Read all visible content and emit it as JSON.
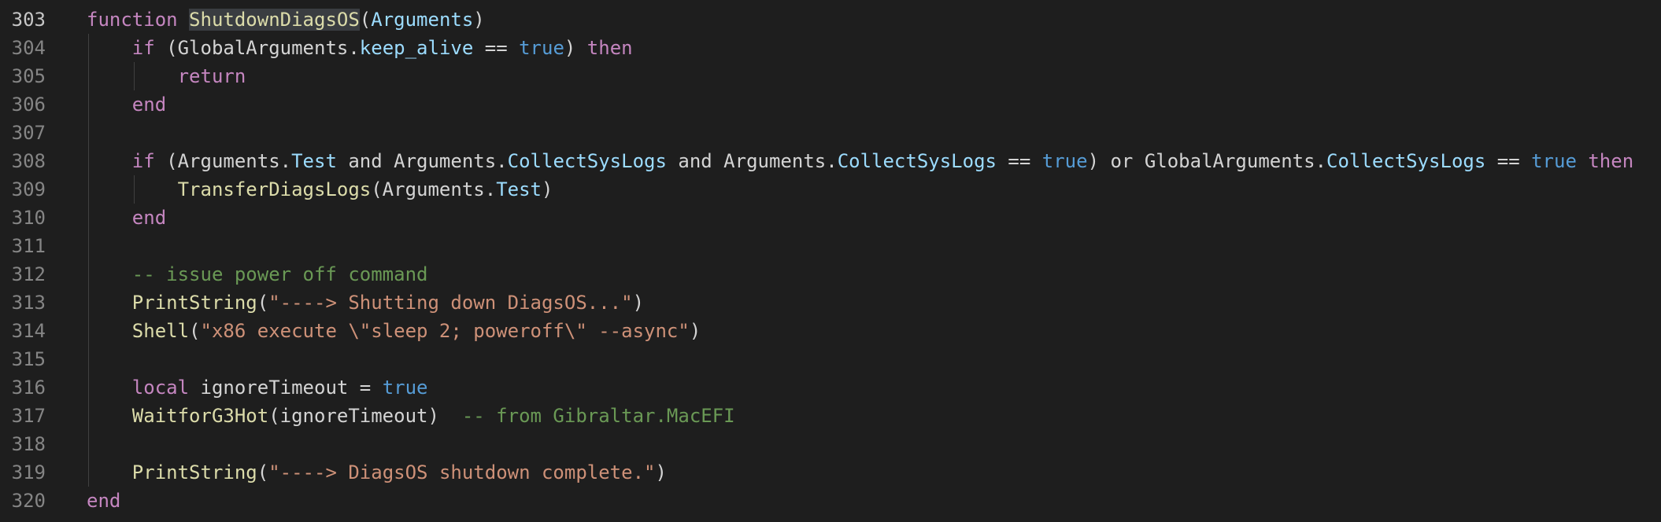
{
  "theme": {
    "background": "#1e1e1e",
    "line_number": "#858585",
    "line_number_active": "#c6c6c6",
    "keyword": "#c586c0",
    "function": "#dcdcaa",
    "property": "#9cdcfe",
    "boolean": "#569cd6",
    "string": "#ce9178",
    "comment": "#6a9955",
    "text": "#d4d4d4",
    "selection_highlight": "#3a3d41",
    "indent_guide": "#404040"
  },
  "editor": {
    "active_line": 303,
    "lines": [
      {
        "n": "303",
        "indent": 0,
        "tokens": [
          {
            "t": "function",
            "k": "kw"
          },
          {
            "t": " ",
            "k": "id"
          },
          {
            "t": "ShutdownDiagsOS",
            "k": "fn",
            "hl": true
          },
          {
            "t": "(",
            "k": "id"
          },
          {
            "t": "Arguments",
            "k": "prop"
          },
          {
            "t": ")",
            "k": "id"
          }
        ]
      },
      {
        "n": "304",
        "indent": 1,
        "tokens": [
          {
            "t": "if",
            "k": "kw"
          },
          {
            "t": " (GlobalArguments.",
            "k": "id"
          },
          {
            "t": "keep_alive",
            "k": "prop"
          },
          {
            "t": " == ",
            "k": "id"
          },
          {
            "t": "true",
            "k": "bool"
          },
          {
            "t": ") ",
            "k": "id"
          },
          {
            "t": "then",
            "k": "kw"
          }
        ]
      },
      {
        "n": "305",
        "indent": 2,
        "tokens": [
          {
            "t": "return",
            "k": "kw"
          }
        ]
      },
      {
        "n": "306",
        "indent": 1,
        "tokens": [
          {
            "t": "end",
            "k": "kw"
          }
        ]
      },
      {
        "n": "307",
        "indent": 0,
        "tokens": []
      },
      {
        "n": "308",
        "indent": 1,
        "tokens": [
          {
            "t": "if",
            "k": "kw"
          },
          {
            "t": " (Arguments.",
            "k": "id"
          },
          {
            "t": "Test",
            "k": "prop"
          },
          {
            "t": " and Arguments.",
            "k": "id"
          },
          {
            "t": "CollectSysLogs",
            "k": "prop"
          },
          {
            "t": " and Arguments.",
            "k": "id"
          },
          {
            "t": "CollectSysLogs",
            "k": "prop"
          },
          {
            "t": " == ",
            "k": "id"
          },
          {
            "t": "true",
            "k": "bool"
          },
          {
            "t": ") or GlobalArguments.",
            "k": "id"
          },
          {
            "t": "CollectSysLogs",
            "k": "prop"
          },
          {
            "t": " == ",
            "k": "id"
          },
          {
            "t": "true",
            "k": "bool"
          },
          {
            "t": " ",
            "k": "id"
          },
          {
            "t": "then",
            "k": "kw"
          }
        ]
      },
      {
        "n": "309",
        "indent": 2,
        "tokens": [
          {
            "t": "TransferDiagsLogs",
            "k": "fn"
          },
          {
            "t": "(Arguments.",
            "k": "id"
          },
          {
            "t": "Test",
            "k": "prop"
          },
          {
            "t": ")",
            "k": "id"
          }
        ]
      },
      {
        "n": "310",
        "indent": 1,
        "tokens": [
          {
            "t": "end",
            "k": "kw"
          }
        ]
      },
      {
        "n": "311",
        "indent": 0,
        "tokens": []
      },
      {
        "n": "312",
        "indent": 1,
        "tokens": [
          {
            "t": "-- issue power off command",
            "k": "cmt"
          }
        ]
      },
      {
        "n": "313",
        "indent": 1,
        "tokens": [
          {
            "t": "PrintString",
            "k": "fn"
          },
          {
            "t": "(",
            "k": "id"
          },
          {
            "t": "\"----> Shutting down DiagsOS...\"",
            "k": "str"
          },
          {
            "t": ")",
            "k": "id"
          }
        ]
      },
      {
        "n": "314",
        "indent": 1,
        "tokens": [
          {
            "t": "Shell",
            "k": "fn"
          },
          {
            "t": "(",
            "k": "id"
          },
          {
            "t": "\"x86 execute \\\"sleep 2; poweroff\\\" --async\"",
            "k": "str"
          },
          {
            "t": ")",
            "k": "id"
          }
        ]
      },
      {
        "n": "315",
        "indent": 0,
        "tokens": []
      },
      {
        "n": "316",
        "indent": 1,
        "tokens": [
          {
            "t": "local",
            "k": "kw"
          },
          {
            "t": " ignoreTimeout = ",
            "k": "id"
          },
          {
            "t": "true",
            "k": "bool"
          }
        ]
      },
      {
        "n": "317",
        "indent": 1,
        "tokens": [
          {
            "t": "WaitforG3Hot",
            "k": "fn"
          },
          {
            "t": "(ignoreTimeout)  ",
            "k": "id"
          },
          {
            "t": "-- from Gibraltar.MacEFI",
            "k": "cmt"
          }
        ]
      },
      {
        "n": "318",
        "indent": 0,
        "tokens": []
      },
      {
        "n": "319",
        "indent": 1,
        "tokens": [
          {
            "t": "PrintString",
            "k": "fn"
          },
          {
            "t": "(",
            "k": "id"
          },
          {
            "t": "\"----> DiagsOS shutdown complete.\"",
            "k": "str"
          },
          {
            "t": ")",
            "k": "id"
          }
        ]
      },
      {
        "n": "320",
        "indent": 0,
        "tokens": [
          {
            "t": "end",
            "k": "kw"
          }
        ]
      }
    ]
  }
}
